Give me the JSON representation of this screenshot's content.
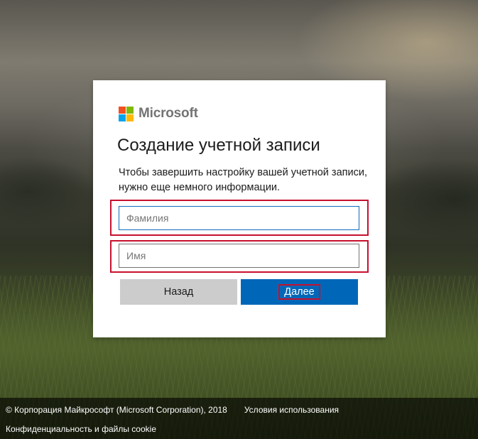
{
  "brand": {
    "name": "Microsoft",
    "logo_colors": [
      "#f25022",
      "#7fba00",
      "#00a4ef",
      "#ffb900"
    ]
  },
  "card": {
    "title": "Создание учетной записи",
    "description": "Чтобы завершить настройку вашей учетной записи, нужно еще немного информации.",
    "fields": {
      "surname": {
        "placeholder": "Фамилия",
        "value": ""
      },
      "name": {
        "placeholder": "Имя",
        "value": ""
      }
    },
    "buttons": {
      "back": "Назад",
      "next": "Далее"
    }
  },
  "footer": {
    "copyright": "© Корпорация Майкрософт (Microsoft Corporation), 2018",
    "terms": "Условия использования",
    "privacy": "Конфиденциальность и файлы cookie"
  },
  "colors": {
    "accent": "#0067b8",
    "highlight": "#c8102e"
  }
}
